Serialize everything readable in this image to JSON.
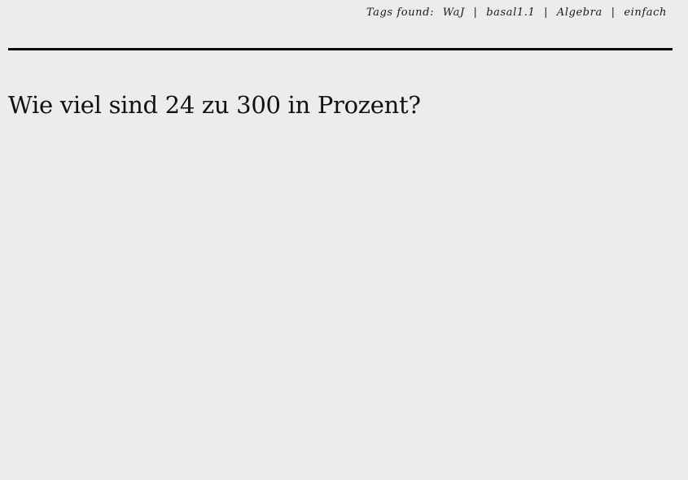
{
  "header": {
    "tags_label": "Tags found:",
    "tags": [
      "WaJ",
      "basal1.1",
      "Algebra",
      "einfach"
    ],
    "separator": "|"
  },
  "main": {
    "question": "Wie viel sind 24 zu 300 in Prozent?"
  }
}
